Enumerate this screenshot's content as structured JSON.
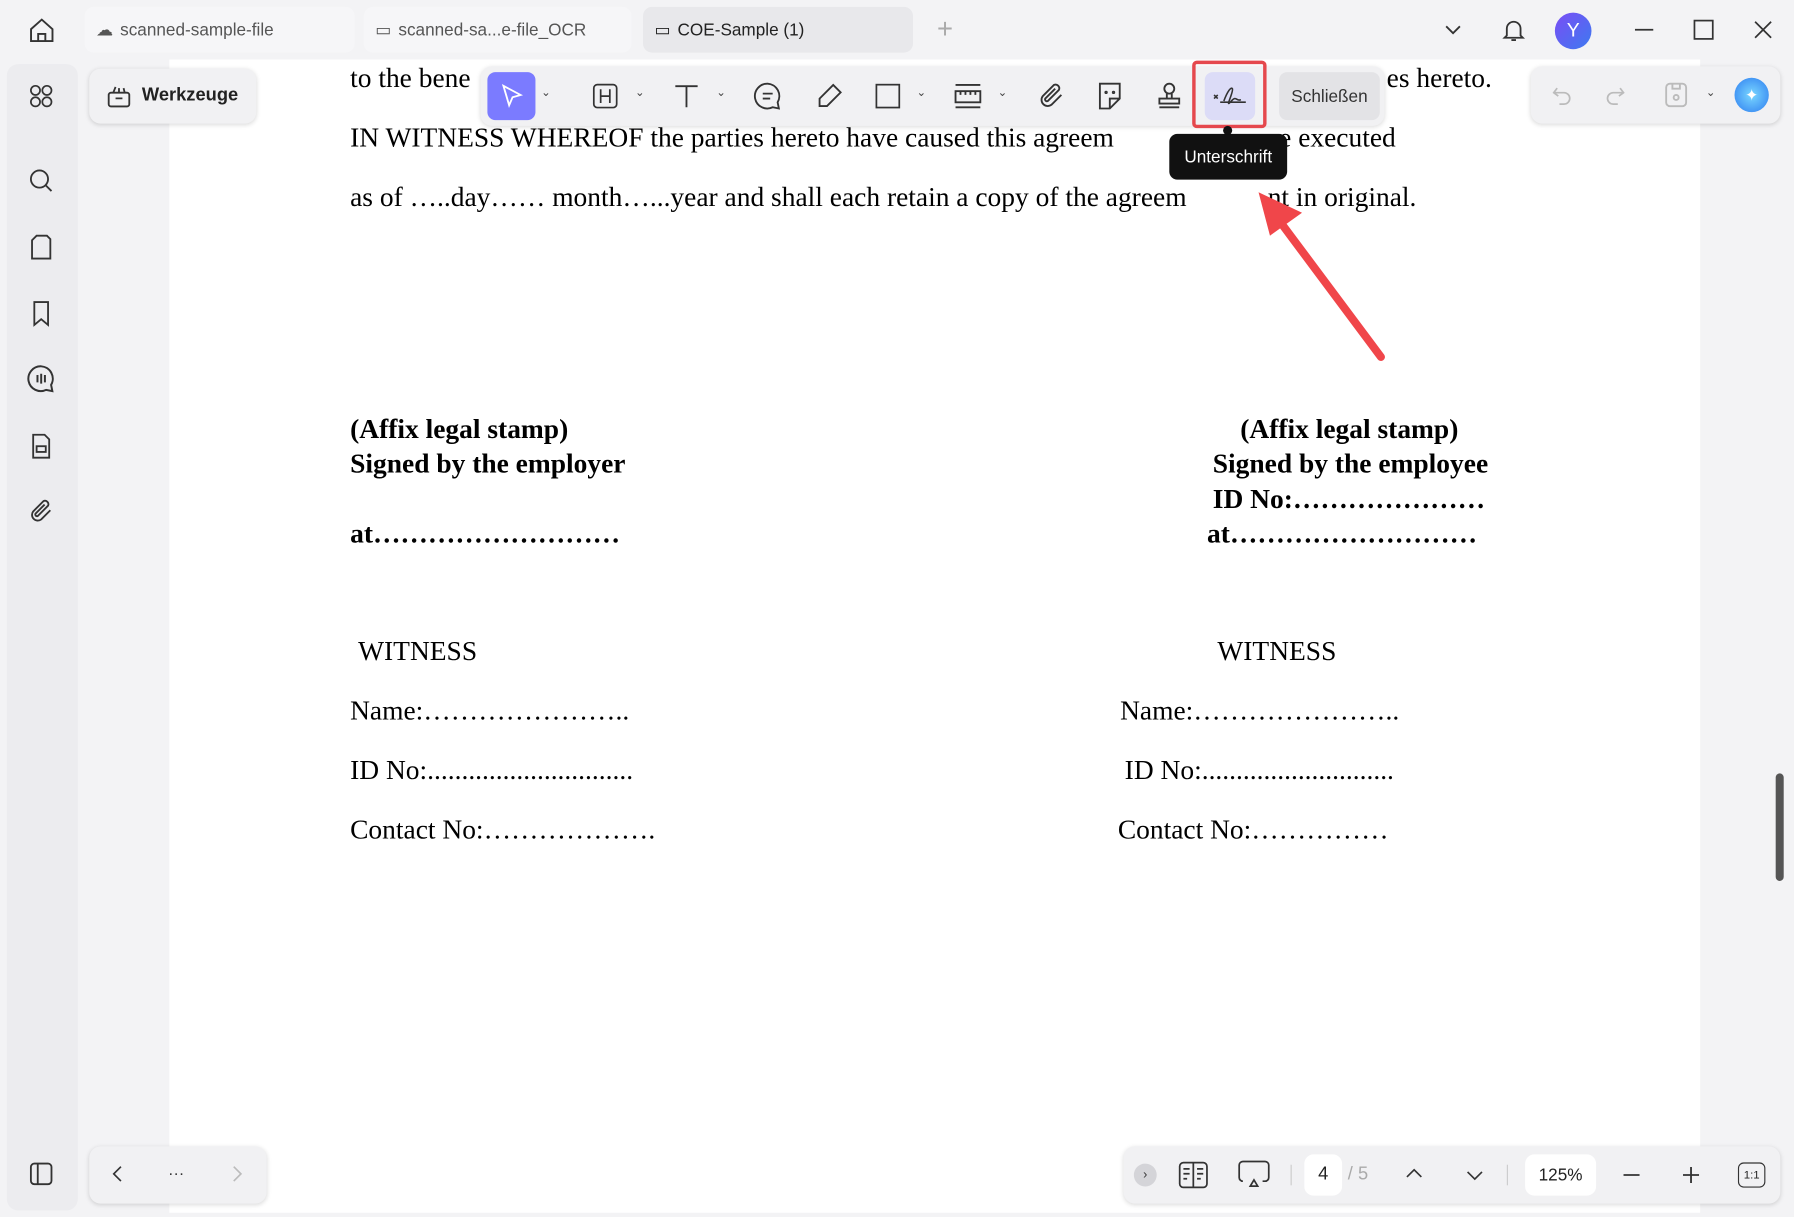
{
  "tabs": [
    {
      "label": "scanned-sample-file",
      "icon": "cloud-icon"
    },
    {
      "label": "scanned-sa...e-file_OCR",
      "icon": "monitor-icon"
    },
    {
      "label": "COE-Sample (1)",
      "icon": "monitor-icon",
      "active": true
    }
  ],
  "user": {
    "avatar_letter": "Y"
  },
  "tools_button": {
    "label": "Werkzeuge"
  },
  "toolbar": {
    "close_label": "Schließen",
    "tooltip": "Unterschrift",
    "highlight_color": "#e5484d",
    "accent": "#7b7bff"
  },
  "document": {
    "lines": [
      "to the bene",
      "es hereto.",
      "IN WITNESS WHEREOF the parties hereto have caused this agreem",
      "e executed",
      "as of …..day…… month…...year and shall each retain a copy of the agreem",
      "nt in original."
    ],
    "left": {
      "stamp": "(Affix legal stamp)",
      "signed": "Signed by the employer",
      "at": "at………………………",
      "witness": "WITNESS",
      "name": "Name:…………………..",
      "id": "ID No:..............................",
      "contact": "Contact No:………………."
    },
    "right": {
      "stamp": "(Affix legal stamp)",
      "signed": "Signed by the employee",
      "idno": "ID No:…………………",
      "at": "at………………………",
      "witness": "WITNESS",
      "name": "Name:…………………..",
      "id": "ID No:............................",
      "contact": "Contact No:……………"
    }
  },
  "pager": {
    "page": "4",
    "total": "/ 5",
    "zoom": "125%",
    "fit_label": "1:1"
  },
  "bottom_nav": {
    "more": "···"
  }
}
